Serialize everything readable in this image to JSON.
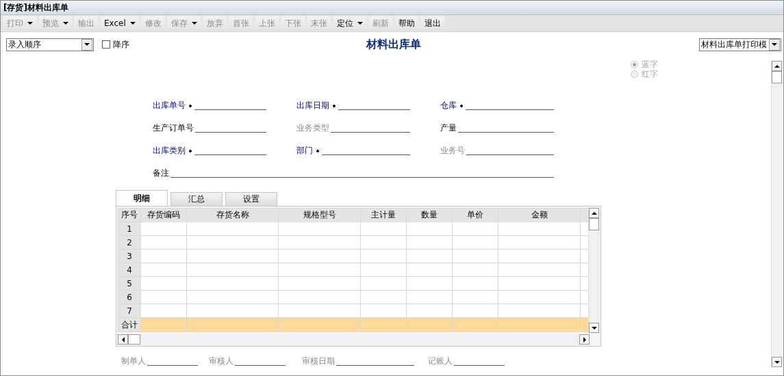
{
  "window": {
    "title": "[存货]材料出库单"
  },
  "toolbar": [
    {
      "label": "打印",
      "dropdown": true,
      "disabled": true
    },
    {
      "label": "预览",
      "dropdown": true,
      "disabled": true
    },
    {
      "label": "输出",
      "dropdown": false,
      "disabled": true
    },
    {
      "label": "Excel",
      "dropdown": true,
      "disabled": false
    },
    {
      "label": "修改",
      "dropdown": false,
      "disabled": true
    },
    {
      "label": "保存",
      "dropdown": true,
      "disabled": true
    },
    {
      "label": "放弃",
      "dropdown": false,
      "disabled": true
    },
    {
      "label": "首张",
      "dropdown": false,
      "disabled": true
    },
    {
      "label": "上张",
      "dropdown": false,
      "disabled": true
    },
    {
      "label": "下张",
      "dropdown": false,
      "disabled": true
    },
    {
      "label": "末张",
      "dropdown": false,
      "disabled": true
    },
    {
      "label": "定位",
      "dropdown": true,
      "disabled": false
    },
    {
      "label": "刷新",
      "dropdown": false,
      "disabled": true
    },
    {
      "label": "帮助",
      "dropdown": false,
      "disabled": false
    },
    {
      "label": "退出",
      "dropdown": false,
      "disabled": false
    }
  ],
  "sort_select": {
    "value": "录入顺序"
  },
  "descending": {
    "label": "降序",
    "checked": false
  },
  "form_title": "材料出库单",
  "template_select": {
    "value": "材料出库单打印模"
  },
  "color_radios": [
    {
      "label": "蓝字",
      "selected": true
    },
    {
      "label": "红字",
      "selected": false
    }
  ],
  "header_fields": [
    {
      "label": "出库单号",
      "required": true,
      "disabled": false
    },
    {
      "label": "出库日期",
      "required": true,
      "disabled": false
    },
    {
      "label": "仓库",
      "required": true,
      "disabled": false
    },
    {
      "label": "生产订单号",
      "required": false,
      "disabled": false
    },
    {
      "label": "业务类型",
      "required": false,
      "disabled": true
    },
    {
      "label": "产量",
      "required": false,
      "disabled": false
    },
    {
      "label": "出库类别",
      "required": true,
      "disabled": false
    },
    {
      "label": "部门",
      "required": true,
      "disabled": false
    },
    {
      "label": "业务号",
      "required": false,
      "disabled": true
    }
  ],
  "remark_field": {
    "label": "备注",
    "required": false,
    "disabled": false
  },
  "tabs": [
    {
      "label": "明细",
      "selected": true
    },
    {
      "label": "汇总",
      "selected": false
    },
    {
      "label": "设置",
      "selected": false
    }
  ],
  "table": {
    "columns": [
      "序号",
      "存货编码",
      "存货名称",
      "规格型号",
      "主计量",
      "数量",
      "单价",
      "金额"
    ],
    "rows": [
      "1",
      "2",
      "3",
      "4",
      "5",
      "6",
      "7"
    ],
    "total_row": {
      "label": "合计"
    }
  },
  "footer_fields": [
    {
      "label": "制单人",
      "disabled": true
    },
    {
      "label": "审核人",
      "disabled": true
    },
    {
      "label": "审核日期",
      "disabled": true
    },
    {
      "label": "记账人",
      "disabled": true
    }
  ]
}
